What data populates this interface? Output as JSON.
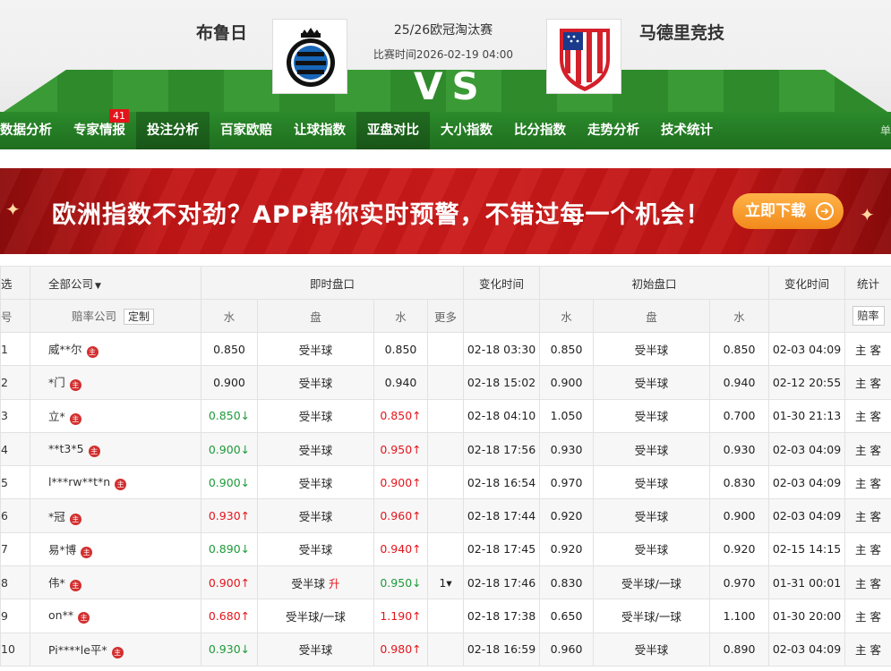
{
  "header": {
    "home_team": "布鲁日",
    "away_team": "马德里竞技",
    "competition": "25/26欧冠淘汰赛",
    "match_time": "比赛时间2026-02-19 04:00",
    "vs": "VS",
    "home_logo_text": "CLUB BRUGGE KV"
  },
  "nav": {
    "items": [
      "数据分析",
      "专家情报",
      "投注分析",
      "百家欧赔",
      "让球指数",
      "亚盘对比",
      "大小指数",
      "比分指数",
      "走势分析",
      "技术统计"
    ],
    "badge": "41",
    "tail": "单"
  },
  "banner": {
    "text": "欧洲指数不对劲？APP帮你实时预警，不错过每一个机会！",
    "button": "立即下载"
  },
  "table": {
    "header1": {
      "select": "选",
      "company": "全部公司",
      "live": "即时盘口",
      "change_time": "变化时间",
      "initial": "初始盘口",
      "change_time2": "变化时间",
      "stats": "统计"
    },
    "header2": {
      "index": "号",
      "company": "赔率公司",
      "custom": "定制",
      "water1": "水",
      "handicap": "盘",
      "water2": "水",
      "more": "更多",
      "iwater1": "水",
      "ihandicap": "盘",
      "iwater2": "水",
      "filter": "赔率"
    },
    "home_mark": "主",
    "stats_text": "主 客",
    "rows": [
      {
        "no": "1",
        "company": "威**尔",
        "w1": "0.850",
        "w1d": "",
        "hc": "受半球",
        "hcf": "",
        "w2": "0.850",
        "w2d": "",
        "more": "",
        "t1": "02-18 03:30",
        "iw1": "0.850",
        "ihc": "受半球",
        "iw2": "0.850",
        "t2": "02-03 04:09"
      },
      {
        "no": "2",
        "company": "*门",
        "w1": "0.900",
        "w1d": "",
        "hc": "受半球",
        "hcf": "",
        "w2": "0.940",
        "w2d": "",
        "more": "",
        "t1": "02-18 15:02",
        "iw1": "0.900",
        "ihc": "受半球",
        "iw2": "0.940",
        "t2": "02-12 20:55"
      },
      {
        "no": "3",
        "company": "立*",
        "w1": "0.850↓",
        "w1d": "down",
        "hc": "受半球",
        "hcf": "",
        "w2": "0.850↑",
        "w2d": "up",
        "more": "",
        "t1": "02-18 04:10",
        "iw1": "1.050",
        "ihc": "受半球",
        "iw2": "0.700",
        "t2": "01-30 21:13"
      },
      {
        "no": "4",
        "company": "**t3*5",
        "w1": "0.900↓",
        "w1d": "down",
        "hc": "受半球",
        "hcf": "",
        "w2": "0.950↑",
        "w2d": "up",
        "more": "",
        "t1": "02-18 17:56",
        "iw1": "0.930",
        "ihc": "受半球",
        "iw2": "0.930",
        "t2": "02-03 04:09"
      },
      {
        "no": "5",
        "company": "l***rw**t*n",
        "w1": "0.900↓",
        "w1d": "down",
        "hc": "受半球",
        "hcf": "",
        "w2": "0.900↑",
        "w2d": "up",
        "more": "",
        "t1": "02-18 16:54",
        "iw1": "0.970",
        "ihc": "受半球",
        "iw2": "0.830",
        "t2": "02-03 04:09"
      },
      {
        "no": "6",
        "company": "*冠",
        "w1": "0.930↑",
        "w1d": "up",
        "hc": "受半球",
        "hcf": "",
        "w2": "0.960↑",
        "w2d": "up",
        "more": "",
        "t1": "02-18 17:44",
        "iw1": "0.920",
        "ihc": "受半球",
        "iw2": "0.900",
        "t2": "02-03 04:09"
      },
      {
        "no": "7",
        "company": "易*博",
        "w1": "0.890↓",
        "w1d": "down",
        "hc": "受半球",
        "hcf": "",
        "w2": "0.940↑",
        "w2d": "up",
        "more": "",
        "t1": "02-18 17:45",
        "iw1": "0.920",
        "ihc": "受半球",
        "iw2": "0.920",
        "t2": "02-15 14:15"
      },
      {
        "no": "8",
        "company": "伟*",
        "w1": "0.900↑",
        "w1d": "up",
        "hc": "受半球",
        "hcf": "升",
        "w2": "0.950↓",
        "w2d": "down",
        "more": "1▾",
        "t1": "02-18 17:46",
        "iw1": "0.830",
        "ihc": "受半球/一球",
        "iw2": "0.970",
        "t2": "01-31 00:01"
      },
      {
        "no": "9",
        "company": "on**",
        "w1": "0.680↑",
        "w1d": "up",
        "hc": "受半球/一球",
        "hcf": "",
        "w2": "1.190↑",
        "w2d": "up",
        "more": "",
        "t1": "02-18 17:38",
        "iw1": "0.650",
        "ihc": "受半球/一球",
        "iw2": "1.100",
        "t2": "01-30 20:00"
      },
      {
        "no": "10",
        "company": "Pi****le平*",
        "w1": "0.930↓",
        "w1d": "down",
        "hc": "受半球",
        "hcf": "",
        "w2": "0.980↑",
        "w2d": "up",
        "more": "",
        "t1": "02-18 16:59",
        "iw1": "0.960",
        "ihc": "受半球",
        "iw2": "0.890",
        "t2": "02-03 04:09"
      }
    ]
  },
  "colors": {
    "nav_green": "#2b8a2b",
    "up_red": "#e4141b",
    "down_green": "#1f9a3a",
    "banner_red": "#c21616",
    "button_orange": "#f28a1b"
  }
}
